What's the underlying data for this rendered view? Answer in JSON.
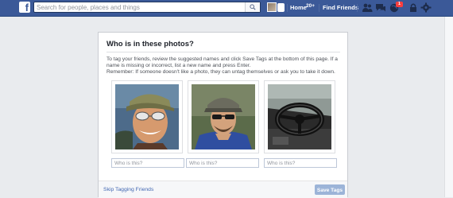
{
  "topbar": {
    "search_placeholder": "Search for people, places and things",
    "nav_home": "Home",
    "home_count": "20+",
    "nav_find_friends": "Find Friends",
    "notification_count": "1"
  },
  "dialog": {
    "title": "Who is in these photos?",
    "instruction_line1": "To tag your friends, review the suggested names and click Save Tags at the bottom of this page. If a name is missing or incorrect, list a new name and press Enter.",
    "instruction_line2": "Remember: If someone doesn't like a photo, they can untag themselves or ask you to take it down.",
    "photos": [
      {
        "input_placeholder": "Who is this?",
        "icon": "woman-sunglasses-photo"
      },
      {
        "input_placeholder": "Who is this?",
        "icon": "man-cap-photo"
      },
      {
        "input_placeholder": "Who is this?",
        "icon": "boat-steering-wheel-photo"
      }
    ],
    "skip_label": "Skip Tagging Friends",
    "save_label": "Save Tags"
  },
  "colors": {
    "topbar": "#3b5998",
    "link": "#4267b2",
    "save_button_disabled": "#9cb4d8",
    "badge": "#fa3e3e"
  }
}
